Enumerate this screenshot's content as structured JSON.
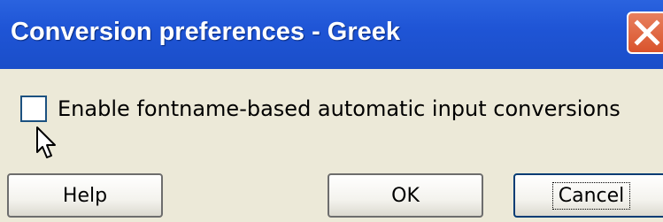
{
  "window": {
    "title": "Conversion preferences - Greek",
    "close_icon": "close-icon"
  },
  "options": {
    "auto_conversion_label": "Enable fontname-based automatic input conversions",
    "auto_conversion_checked": false
  },
  "buttons": {
    "help": "Help",
    "ok": "OK",
    "cancel": "Cancel"
  },
  "colors": {
    "titlebar": "#1f55d6",
    "close": "#d9532c",
    "face": "#ece9d8"
  }
}
